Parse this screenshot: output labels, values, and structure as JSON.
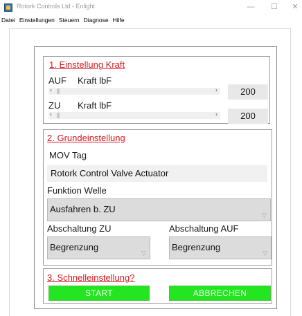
{
  "window": {
    "title": "Rotork Controls Ltd - Enlight",
    "app_icon": "rotork-app-icon",
    "controls": {
      "minimize": "—",
      "maximize": "☐",
      "close": "✕"
    }
  },
  "menu": [
    "Datei",
    "Einstellungen",
    "Steuern",
    "Diagnose",
    "Hilfe"
  ],
  "section1": {
    "title": "1. Einstellung Kraft",
    "open": {
      "label": "AUF",
      "unit": "Kraft lbF",
      "value": "200"
    },
    "close": {
      "label": "ZU",
      "unit": "Kraft lbF",
      "value": "200"
    },
    "scroll_left": "‹",
    "scroll_right": "›"
  },
  "section2": {
    "title": "2. Grundeinstellung",
    "mov_tag_label": "MOV Tag",
    "mov_tag_value": "Rotork Control Valve Actuator",
    "function_label": "Funktion Welle",
    "function_value": "Ausfahren b. ZU",
    "shutoff_close_label": "Abschaltung ZU",
    "shutoff_close_value": "Begrenzung",
    "shutoff_open_label": "Abschaltung AUF",
    "shutoff_open_value": "Begrenzung",
    "dropdown_icon": "chevron-down-icon"
  },
  "section3": {
    "title": "3. Schnelleinstellung?",
    "start_label": "START",
    "cancel_label": "ABBRECHEN"
  },
  "colors": {
    "accent_red": "#d71920",
    "button_green": "#23e620"
  }
}
